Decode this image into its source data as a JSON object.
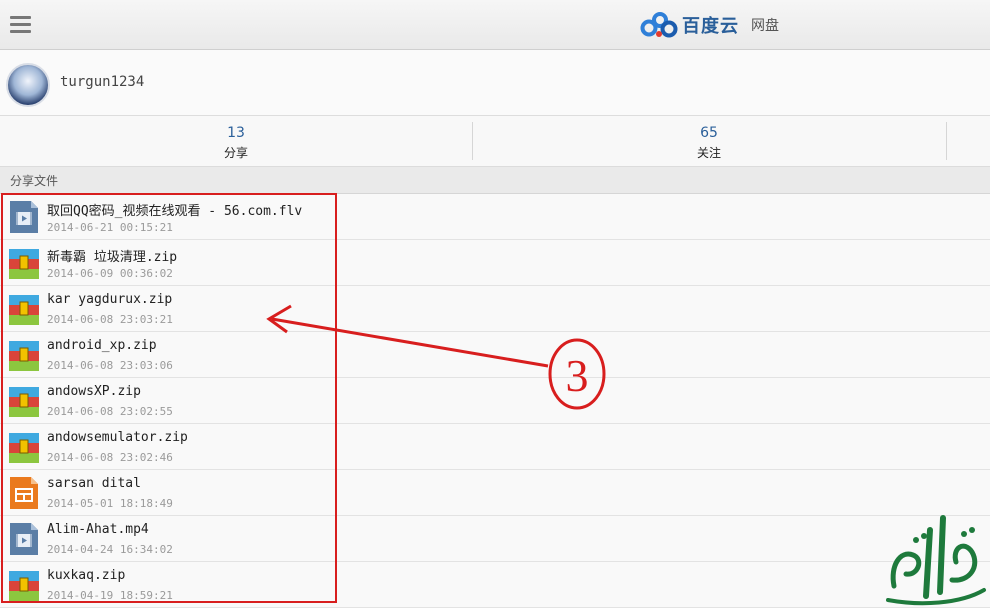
{
  "header": {
    "brand_name": "百度云",
    "brand_sub": "网盘"
  },
  "profile": {
    "username": "turgun1234"
  },
  "stats": [
    {
      "value": "13",
      "label": "分享"
    },
    {
      "value": "65",
      "label": "关注"
    }
  ],
  "section": {
    "title": "分享文件"
  },
  "files": [
    {
      "name": "取回QQ密码_视频在线观看 - 56.com.flv",
      "date": "2014-06-21 00:15:21",
      "icon": "video-icon"
    },
    {
      "name": "新毒霸 垃圾清理.zip",
      "date": "2014-06-09 00:36:02",
      "icon": "zip-icon"
    },
    {
      "name": "kar yagdurux.zip",
      "date": "2014-06-08 23:03:21",
      "icon": "zip-icon"
    },
    {
      "name": "android_xp.zip",
      "date": "2014-06-08 23:03:06",
      "icon": "zip-icon"
    },
    {
      "name": "andowsXP.zip",
      "date": "2014-06-08 23:02:55",
      "icon": "zip-icon"
    },
    {
      "name": "andowsemulator.zip",
      "date": "2014-06-08 23:02:46",
      "icon": "zip-icon"
    },
    {
      "name": "sarsan dital",
      "date": "2014-05-01 18:18:49",
      "icon": "document-icon"
    },
    {
      "name": "Alim-Ahat.mp4",
      "date": "2014-04-24 16:34:02",
      "icon": "video-icon"
    },
    {
      "name": "kuxkaq.zip",
      "date": "2014-04-19 18:59:21",
      "icon": "zip-icon"
    }
  ],
  "annotation": {
    "marker": "③",
    "color": "#d81e1e"
  },
  "colors": {
    "accent": "#2a5f9a",
    "highlight": "#d81e1e"
  }
}
